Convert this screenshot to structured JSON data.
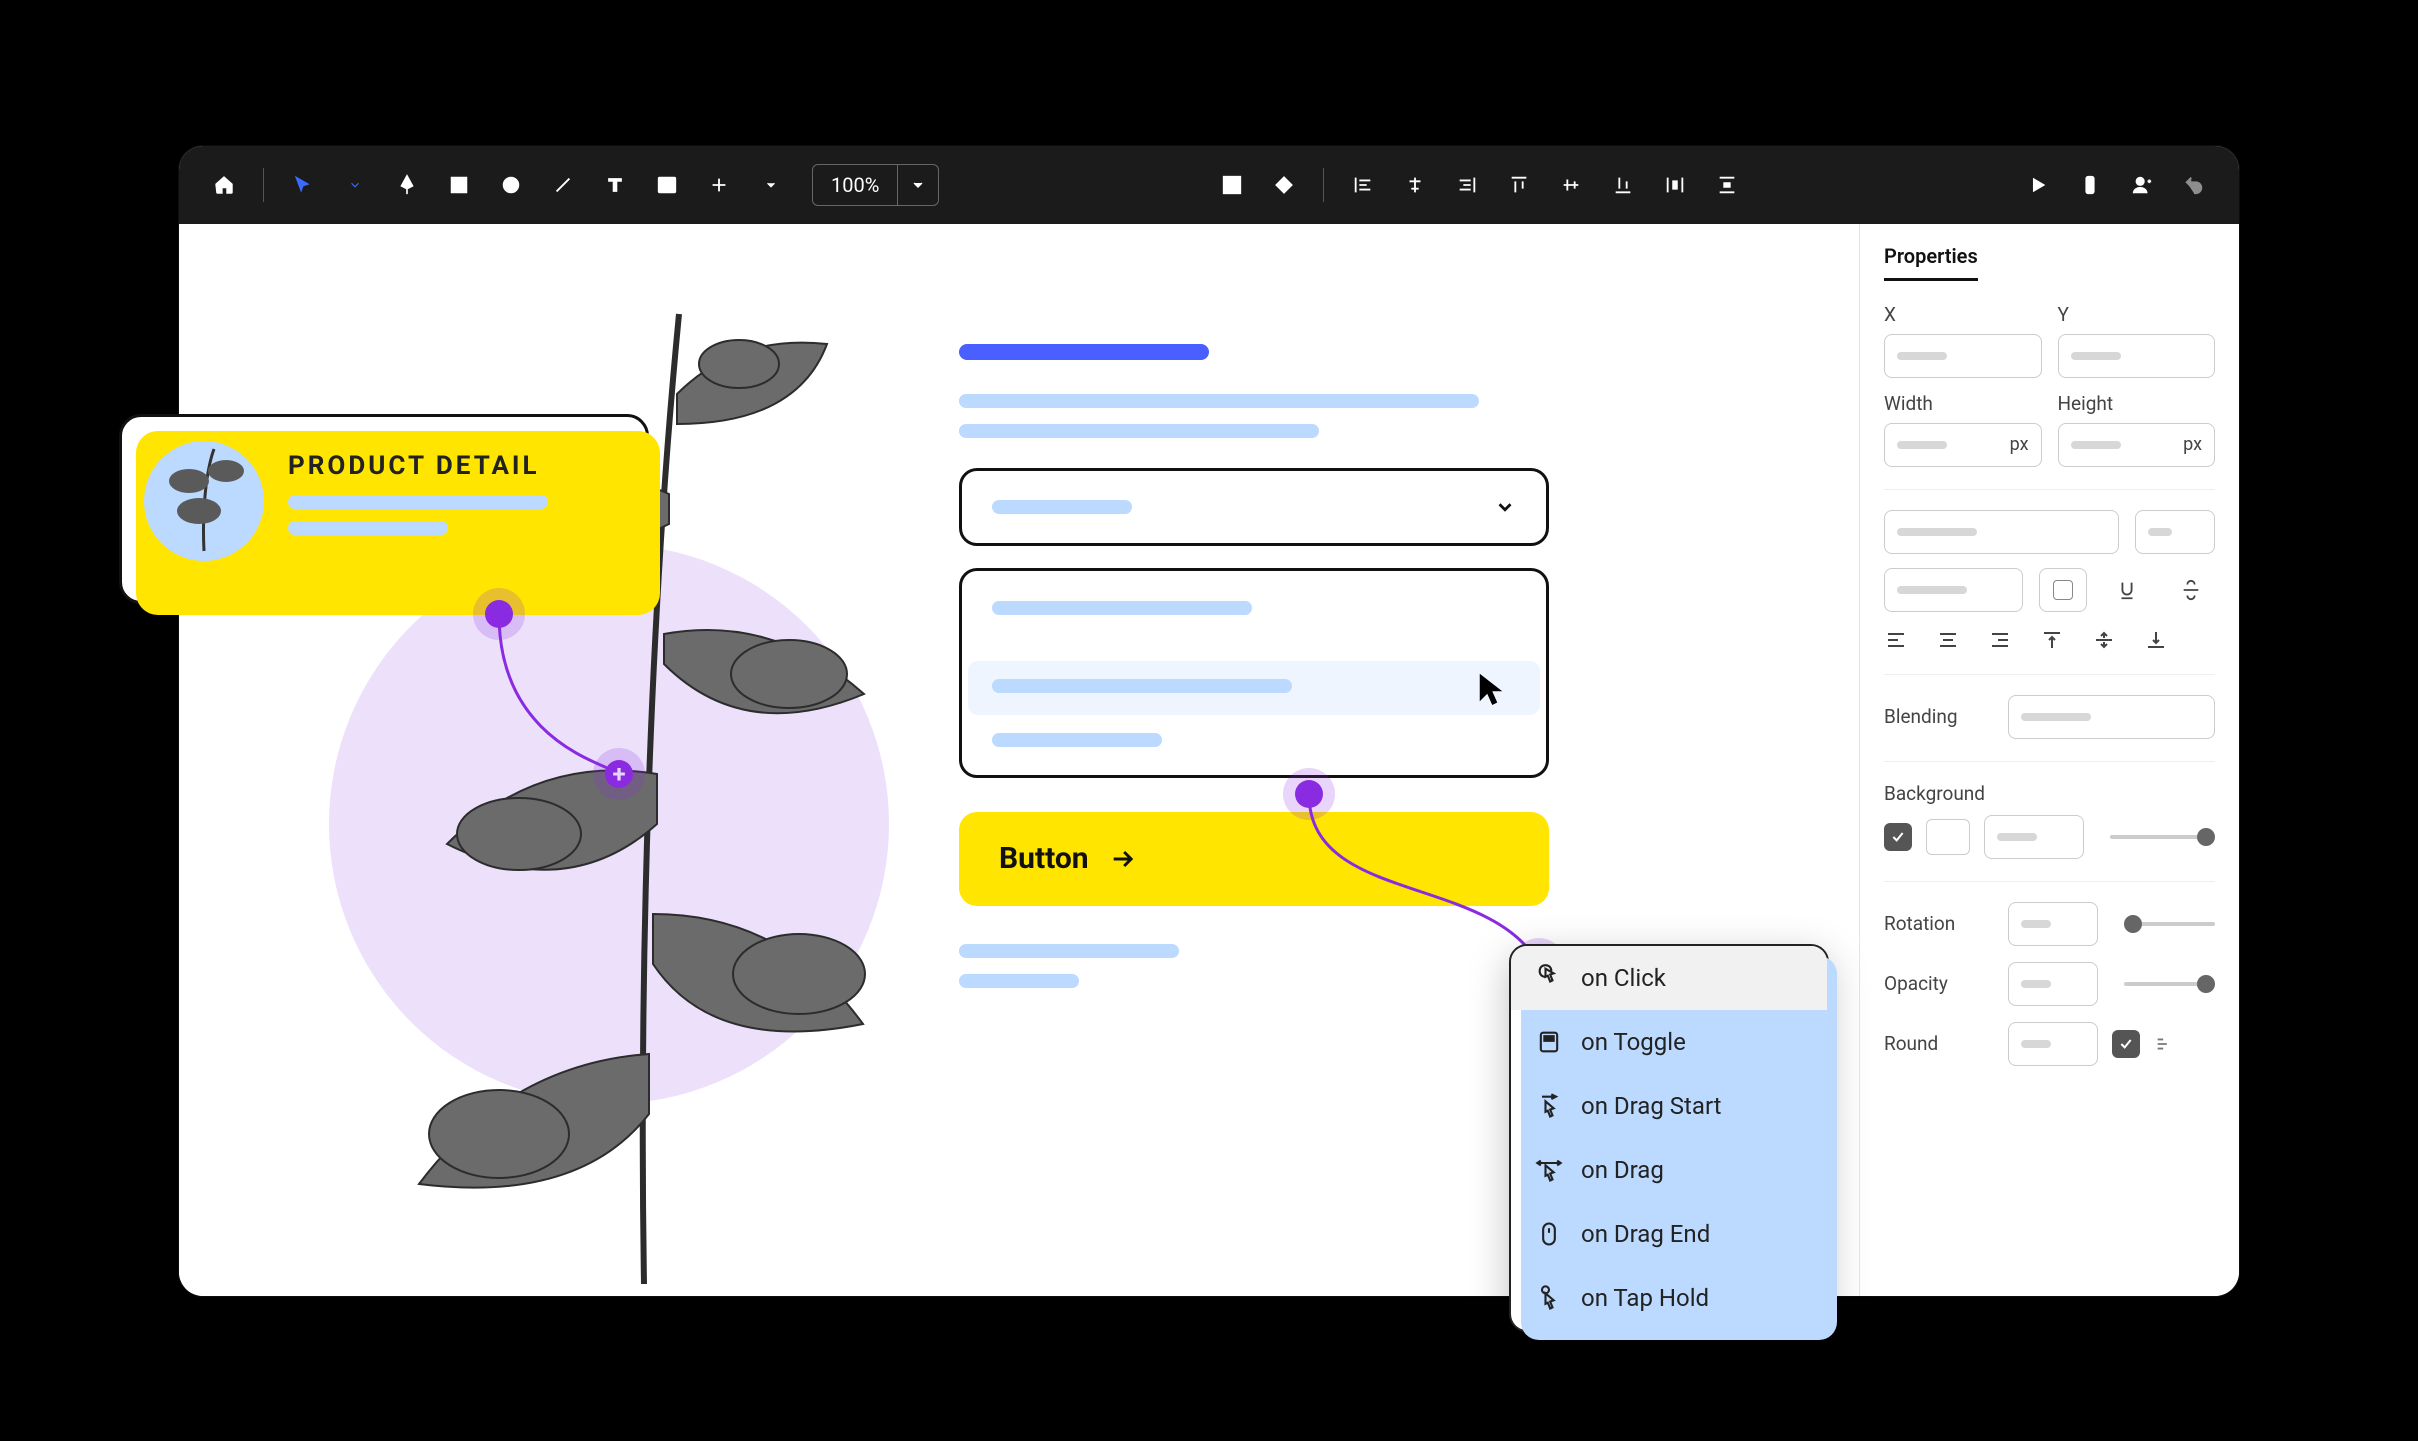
{
  "toolbar": {
    "zoom": "100%"
  },
  "canvas": {
    "product_card_title": "PRODUCT DETAIL",
    "button_label": "Button"
  },
  "interaction_menu": {
    "items": [
      {
        "label": "on Click"
      },
      {
        "label": "on Toggle"
      },
      {
        "label": "on Drag Start"
      },
      {
        "label": "on Drag"
      },
      {
        "label": "on Drag End"
      },
      {
        "label": "on Tap Hold"
      }
    ]
  },
  "properties": {
    "tab": "Properties",
    "x_label": "X",
    "y_label": "Y",
    "width_label": "Width",
    "height_label": "Height",
    "width_unit": "px",
    "height_unit": "px",
    "blending_label": "Blending",
    "background_label": "Background",
    "rotation_label": "Rotation",
    "opacity_label": "Opacity",
    "round_label": "Round"
  }
}
